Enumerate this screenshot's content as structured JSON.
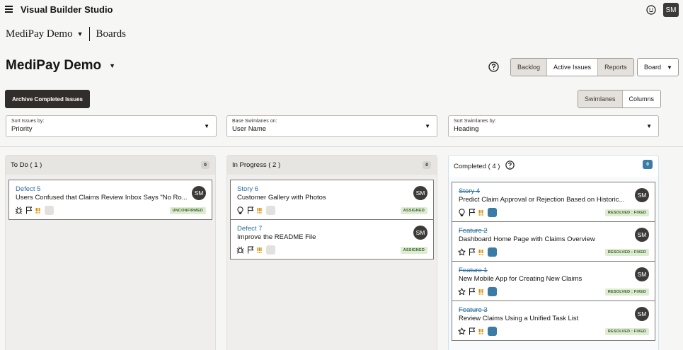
{
  "app": {
    "title": "Visual Builder Studio",
    "user_initials": "SM"
  },
  "breadcrumb": {
    "project": "MediPay Demo",
    "page": "Boards"
  },
  "page": {
    "title": "MediPay Demo"
  },
  "toolbar": {
    "views": [
      {
        "label": "Backlog",
        "active": false
      },
      {
        "label": "Active Issues",
        "active": true
      },
      {
        "label": "Reports",
        "active": false
      }
    ],
    "board_label": "Board",
    "archive_label": "Archive Completed Issues",
    "swimlanes_label": "Swimlanes",
    "columns_label": "Columns"
  },
  "filters": [
    {
      "label": "Sort Issues by:",
      "value": "Priority"
    },
    {
      "label": "Base Swimlanes on:",
      "value": "User Name"
    },
    {
      "label": "Sort Swimlanes by:",
      "value": "Heading"
    }
  ],
  "columns": [
    {
      "title": "To Do ( 1 )",
      "count": "0",
      "cards": [
        {
          "key": "Defect 5",
          "title": "Users Confused that Claims Review Inbox Says \"No Ro...",
          "status": "UNCONFIRMED",
          "type": "defect",
          "avatar": "SM"
        }
      ]
    },
    {
      "title": "In Progress ( 2 )",
      "count": "0",
      "cards": [
        {
          "key": "Story 6",
          "title": "Customer Gallery with Photos",
          "status": "ASSIGNED",
          "type": "story",
          "avatar": "SM"
        },
        {
          "key": "Defect 7",
          "title": "Improve the README File",
          "status": "ASSIGNED",
          "type": "defect",
          "avatar": "SM"
        }
      ]
    },
    {
      "title": "Completed ( 4 )",
      "count": "0",
      "cards": [
        {
          "key": "Story 4",
          "title": "Predict Claim Approval or Rejection Based on Historic...",
          "status": "RESOLVED : FIXED",
          "type": "story",
          "avatar": "SM"
        },
        {
          "key": "Feature 2",
          "title": "Dashboard Home Page with Claims Overview",
          "status": "RESOLVED : FIXED",
          "type": "feature",
          "avatar": "SM"
        },
        {
          "key": "Feature 1",
          "title": "New Mobile App for Creating New Claims",
          "status": "RESOLVED : FIXED",
          "type": "feature",
          "avatar": "SM"
        },
        {
          "key": "Feature 3",
          "title": "Review Claims Using a Unified Task List",
          "status": "RESOLVED : FIXED",
          "type": "feature",
          "avatar": "SM"
        }
      ]
    }
  ],
  "colors": {
    "accent_blue": "#3b7ca6",
    "link_blue": "#2c6da0",
    "dark_button": "#312d2a",
    "status_green_bg": "#dfecd4"
  },
  "icons": {
    "menu": "hamburger-icon",
    "feedback": "smiley-icon",
    "help": "help-icon",
    "defect": "bug-icon",
    "story": "lightbulb-icon",
    "feature": "star-icon",
    "flag": "flag-icon",
    "priority": "priority-icon"
  }
}
